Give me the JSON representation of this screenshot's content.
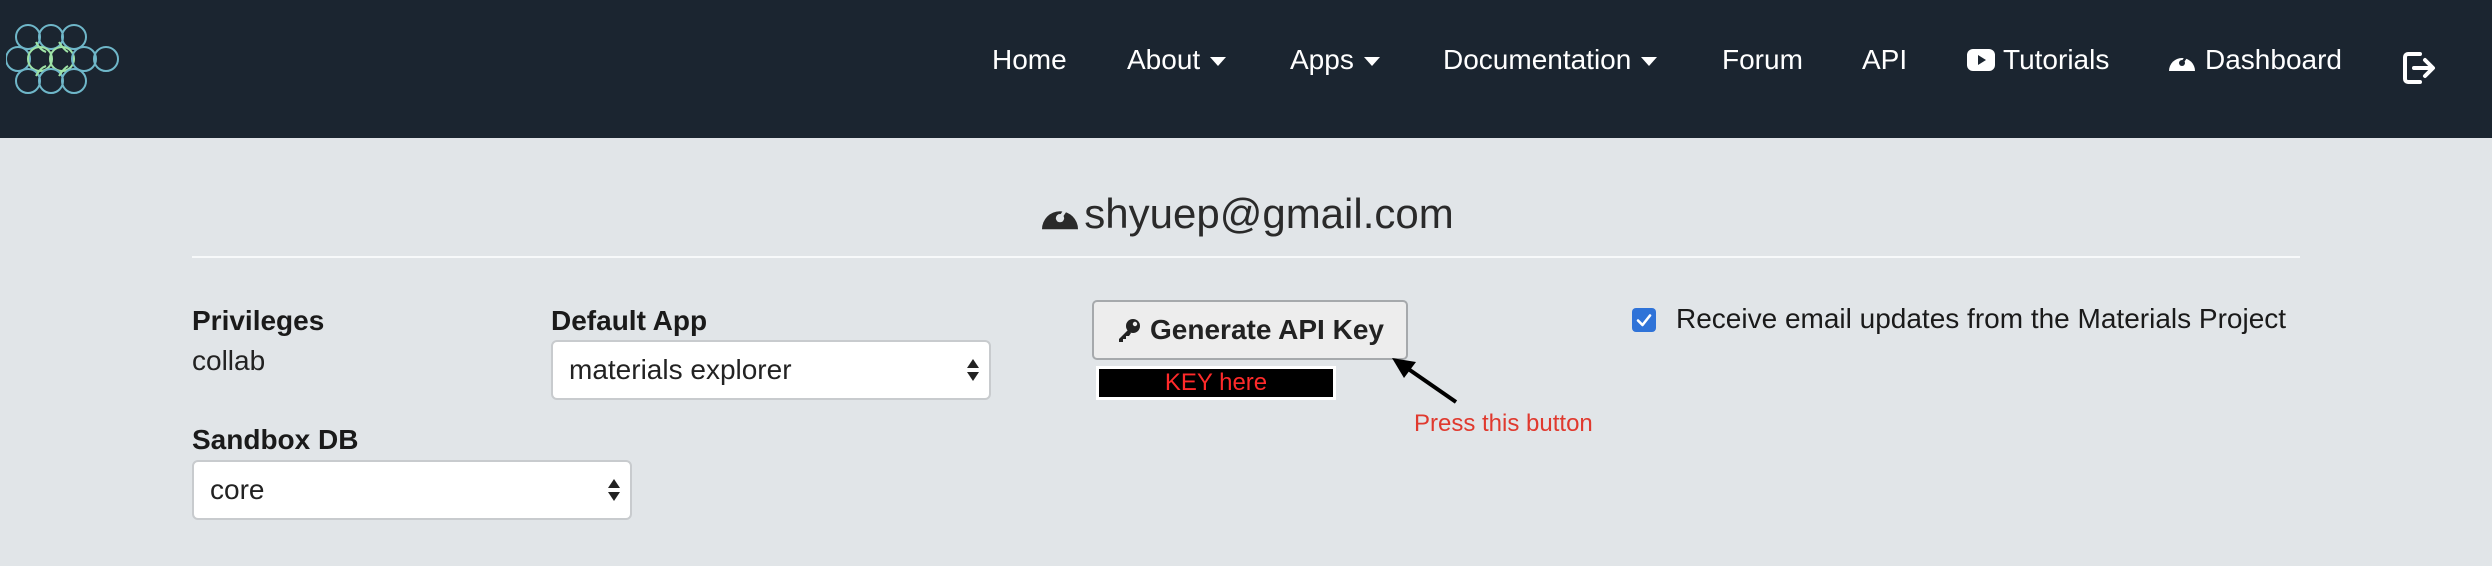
{
  "nav": {
    "home": "Home",
    "about": "About",
    "apps": "Apps",
    "documentation": "Documentation",
    "forum": "Forum",
    "api": "API",
    "tutorials": "Tutorials",
    "dashboard": "Dashboard"
  },
  "profile": {
    "email": "shyuep@gmail.com"
  },
  "privileges": {
    "label": "Privileges",
    "value": "collab"
  },
  "default_app": {
    "label": "Default App",
    "selected": "materials explorer"
  },
  "sandbox": {
    "label": "Sandbox DB",
    "selected": "core"
  },
  "api_key": {
    "button_label": "Generate API Key",
    "key_value": "KEY here",
    "annotation": "Press this button"
  },
  "email_updates": {
    "checked": true,
    "label": "Receive email updates from the Materials Project"
  },
  "colors": {
    "navbar": "#1b2530",
    "page_bg": "#e1e5e8",
    "annotation_red": "#e0392e",
    "checkbox_blue": "#2f73d8"
  }
}
